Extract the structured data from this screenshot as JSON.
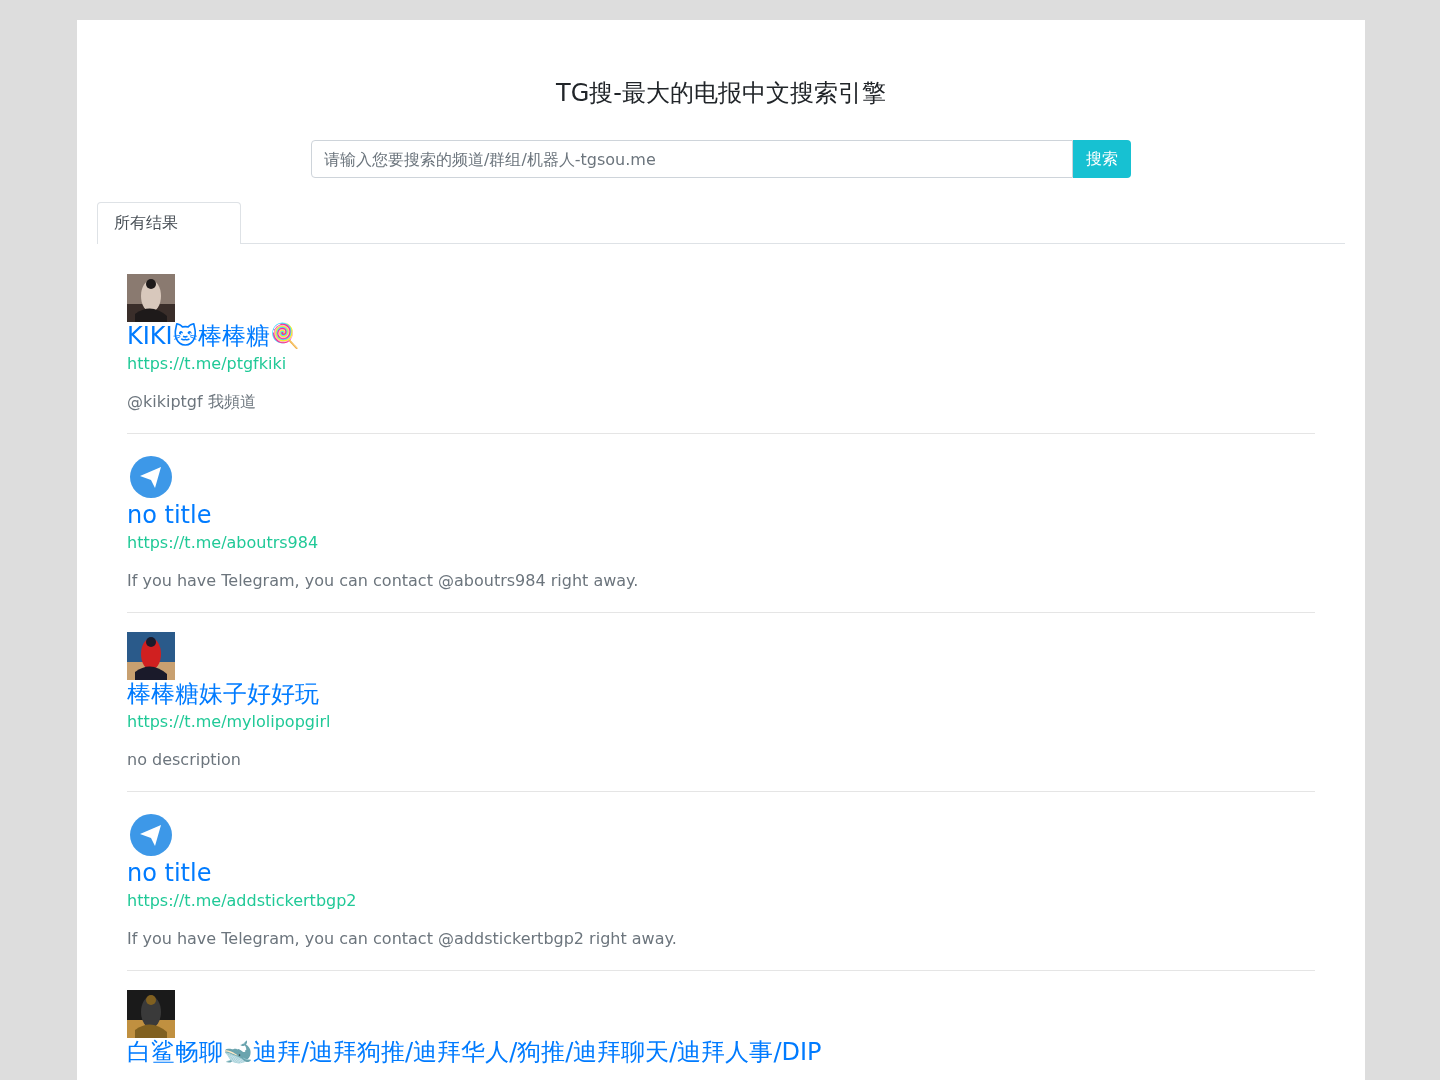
{
  "header": {
    "title": "TG搜-最大的电报中文搜索引擎"
  },
  "search": {
    "placeholder": "请输入您要搜索的频道/群组/机器人-tgsou.me",
    "button": "搜索"
  },
  "tabs": [
    {
      "label": "所有结果",
      "selected": true
    }
  ],
  "results": [
    {
      "kind": "picture",
      "title": "KIKI🐱棒棒糖🍭",
      "link": "https://t.me/ptgfkiki",
      "description": "@kikiptgf 我頻道"
    },
    {
      "kind": "telegram",
      "title": "no title",
      "link": "https://t.me/aboutrs984",
      "description": "If you have Telegram, you can contact @aboutrs984 right away."
    },
    {
      "kind": "picture",
      "title": "棒棒糖妹子好好玩",
      "link": "https://t.me/mylolipopgirl",
      "description": "no description"
    },
    {
      "kind": "telegram",
      "title": "no title",
      "link": "https://t.me/addstickertbgp2",
      "description": "If you have Telegram, you can contact @addstickertbgp2 right away."
    },
    {
      "kind": "picture",
      "title": "白鲨畅聊🐋迪拜/迪拜狗推/迪拜华人/狗推/迪拜聊天/迪拜人事/DIP"
    }
  ]
}
